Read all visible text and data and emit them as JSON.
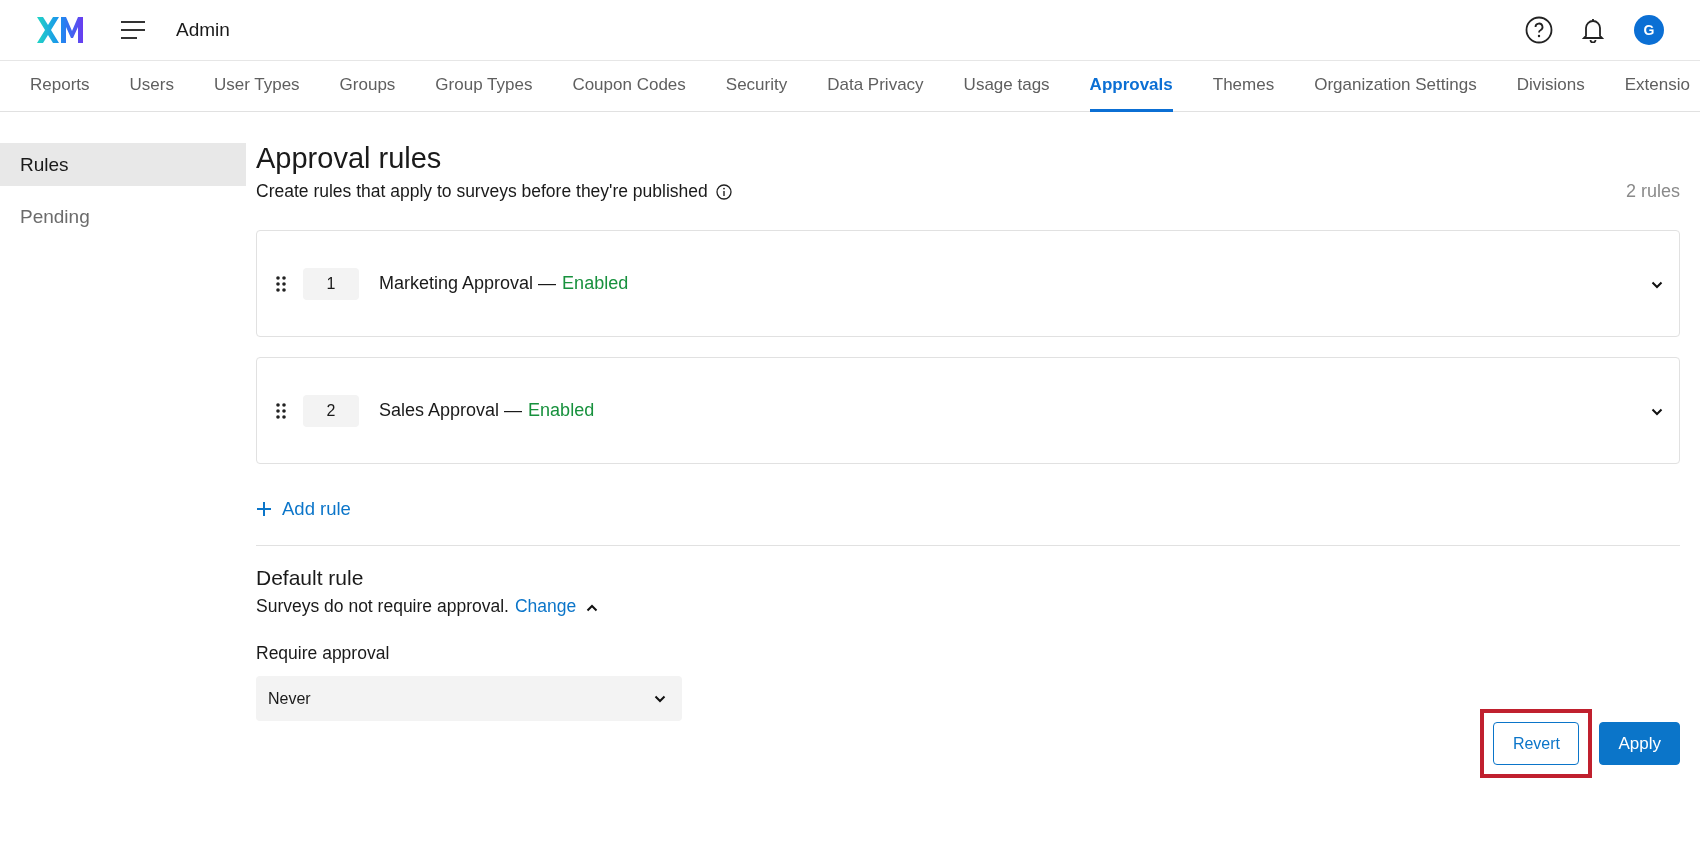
{
  "header": {
    "title": "Admin",
    "avatar": "G"
  },
  "tabs": [
    {
      "label": "Reports",
      "selected": false
    },
    {
      "label": "Users",
      "selected": false
    },
    {
      "label": "User Types",
      "selected": false
    },
    {
      "label": "Groups",
      "selected": false
    },
    {
      "label": "Group Types",
      "selected": false
    },
    {
      "label": "Coupon Codes",
      "selected": false
    },
    {
      "label": "Security",
      "selected": false
    },
    {
      "label": "Data Privacy",
      "selected": false
    },
    {
      "label": "Usage tags",
      "selected": false
    },
    {
      "label": "Approvals",
      "selected": true
    },
    {
      "label": "Themes",
      "selected": false
    },
    {
      "label": "Organization Settings",
      "selected": false
    },
    {
      "label": "Divisions",
      "selected": false
    },
    {
      "label": "Extensio",
      "selected": false
    }
  ],
  "sidebar": {
    "items": [
      {
        "label": "Rules",
        "selected": true
      },
      {
        "label": "Pending",
        "selected": false
      }
    ]
  },
  "page": {
    "title": "Approval rules",
    "subtitle": "Create rules that apply to surveys before they're published",
    "count": "2 rules"
  },
  "rules": [
    {
      "number": "1",
      "name": "Marketing Approval",
      "separator": "—",
      "status": "Enabled",
      "expanded": false
    },
    {
      "number": "2",
      "name": "Sales Approval",
      "separator": "—",
      "status": "Enabled",
      "expanded": false
    }
  ],
  "add_rule": "Add rule",
  "default_rule": {
    "title": "Default rule",
    "description": "Surveys do not require approval.",
    "link": "Change",
    "expanded": true,
    "field_label": "Require approval",
    "value": "Never"
  },
  "buttons": [
    {
      "label": "Revert",
      "kind": "secondary",
      "highlighted": true
    },
    {
      "label": "Apply",
      "kind": "primary",
      "highlighted": false
    }
  ]
}
